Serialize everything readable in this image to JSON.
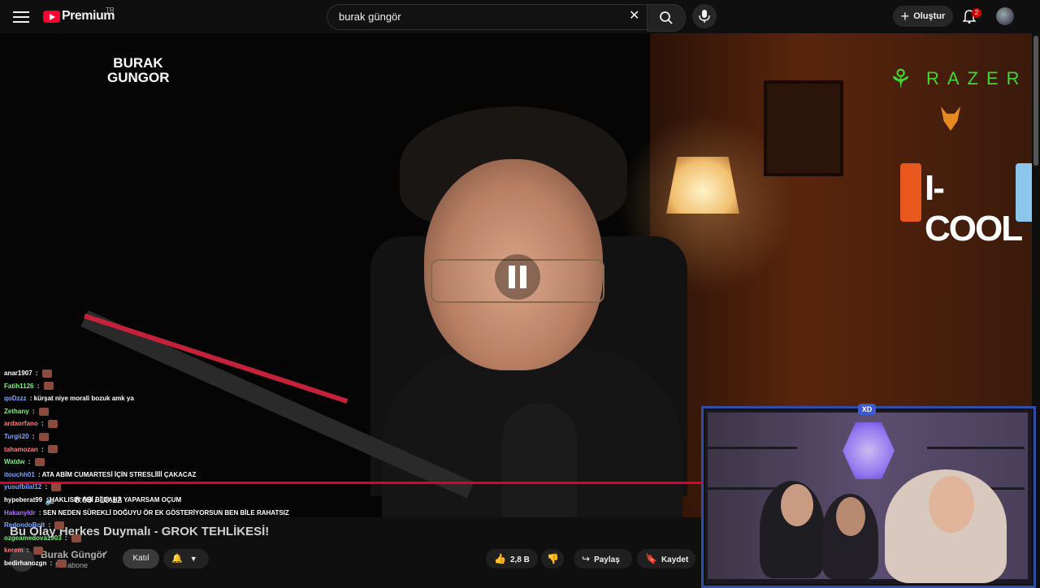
{
  "header": {
    "logo_text": "Premium",
    "region": "TR",
    "search_value": "burak güngör",
    "create_label": "Oluştur",
    "notification_count": "2"
  },
  "video": {
    "brand_overlay_line1": "BURAK",
    "brand_overlay_line2": "GUNGOR",
    "sponsor1": "RAZER",
    "sponsor2": "I-COOL",
    "webcam_badge": "XD",
    "time_display": "8:09 / 10:12",
    "progress_fraction": 0.8
  },
  "chat": [
    {
      "user": "anar1907",
      "msg": "",
      "color": "#ffffff"
    },
    {
      "user": "Fatih1126",
      "msg": "",
      "color": "#7cf07c"
    },
    {
      "user": "qoDzzz",
      "msg": "kürşat niye morali bozuk amk ya",
      "color": "#7aa6ff"
    },
    {
      "user": "Zethany",
      "msg": "",
      "color": "#7cf07c"
    },
    {
      "user": "ardaorfano",
      "msg": "",
      "color": "#ff7a7a"
    },
    {
      "user": "Turgii20",
      "msg": "",
      "color": "#7aa6ff"
    },
    {
      "user": "tahamozan",
      "msg": "",
      "color": "#ff7a7a"
    },
    {
      "user": "Watdw",
      "msg": "",
      "color": "#7cf07c"
    },
    {
      "user": "itouchh01",
      "msg": "ATA ABİM CUMARTESİ İÇİN STRESLİİİİ ÇAKACAZ",
      "color": "#7aa6ff"
    },
    {
      "user": "yusufbilal12",
      "msg": "",
      "color": "#7aa6ff"
    },
    {
      "user": "hypeberat99",
      "msg": "HAKLISIN ABİ Bİ DAHA YAPARSAM OÇUM",
      "color": "#ffffff"
    },
    {
      "user": "Hakanyldr",
      "msg": "SEN NEDEN SÜREKLİ DOĞUYU ÖR EK GÖSTERİYORSUN BEN BİLE RAHATSIZ",
      "color": "#b07aff"
    },
    {
      "user": "RedondoBolt",
      "msg": "",
      "color": "#7aa6ff"
    },
    {
      "user": "ozgeamedova1903",
      "msg": "",
      "color": "#7cf07c"
    },
    {
      "user": "kerem",
      "msg": "",
      "color": "#ff7a7a"
    },
    {
      "user": "bedirhanozgn",
      "msg": "",
      "color": "#ffffff"
    }
  ],
  "below": {
    "title": "Bu Olay Herkes Duymalı - GROK TEHLİKESİ!",
    "channel_name": "Burak Güngör",
    "subscribers": "Mn abone",
    "join_label": "Katıl",
    "like_count": "2,8 B",
    "share_label": "Paylaş",
    "save_label": "Kaydet"
  },
  "icons": {
    "menu": "menu-icon",
    "search": "search-icon",
    "mic": "mic-icon",
    "bell": "bell-icon",
    "like": "thumbs-up-icon",
    "dislike": "thumbs-down-icon",
    "share": "share-icon",
    "save": "save-icon",
    "pause": "pause-icon"
  }
}
